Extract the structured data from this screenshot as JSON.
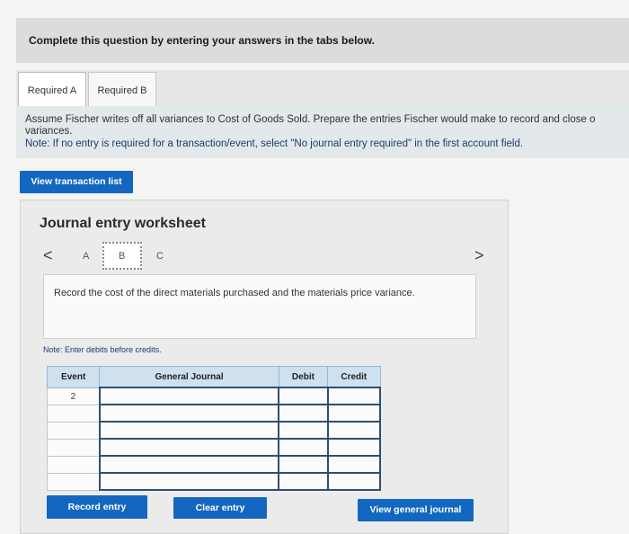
{
  "instruction": "Complete this question by entering your answers in the tabs below.",
  "tabs": [
    {
      "label": "Required A",
      "active": true
    },
    {
      "label": "Required B",
      "active": false
    }
  ],
  "question": {
    "line1": "Assume Fischer writes off all variances to Cost of Goods Sold. Prepare the entries Fischer would make to record and close o",
    "line2": "variances.",
    "note": "Note: If no entry is required for a transaction/event, select \"No journal entry required\" in the first account field."
  },
  "view_transaction_list": "View transaction list",
  "worksheet": {
    "title": "Journal entry worksheet",
    "nav": {
      "prev_icon": "chevron-left-icon",
      "next_icon": "chevron-right-icon",
      "prev": "<",
      "next": ">",
      "letters": [
        "A",
        "B",
        "C"
      ],
      "active": "B"
    },
    "prompt": "Record the cost of the direct materials purchased and the materials price variance.",
    "note": "Note: Enter debits before credits.",
    "table": {
      "headers": [
        "Event",
        "General Journal",
        "Debit",
        "Credit"
      ],
      "rows": [
        {
          "event": "2"
        },
        {
          "event": ""
        },
        {
          "event": ""
        },
        {
          "event": ""
        },
        {
          "event": ""
        },
        {
          "event": ""
        }
      ]
    },
    "buttons": {
      "record": "Record entry",
      "clear": "Clear entry",
      "view_general": "View general journal"
    }
  },
  "colors": {
    "button_blue": "#1467c0",
    "header_blue": "#cfe0ef"
  }
}
